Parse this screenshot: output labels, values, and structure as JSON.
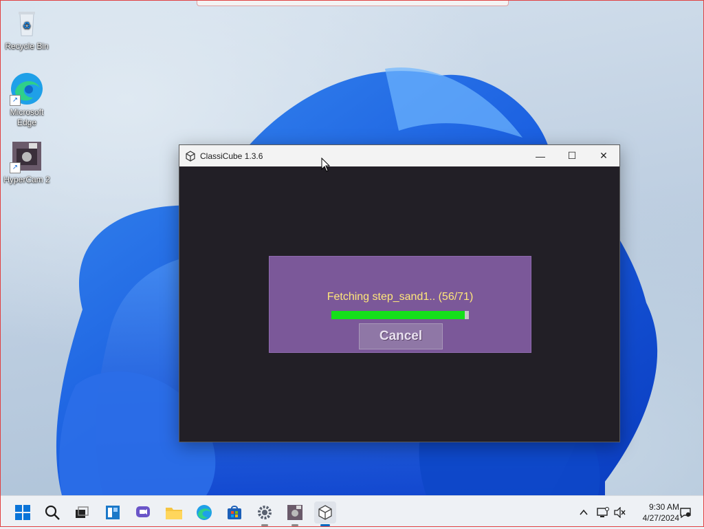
{
  "desktop": {
    "icons": [
      {
        "label": "Recycle Bin",
        "icon": "recycle-bin-icon"
      },
      {
        "label": "Microsoft\nEdge",
        "icon": "edge-icon"
      },
      {
        "label": "HyperCam 2",
        "icon": "hypercam-icon"
      }
    ]
  },
  "window": {
    "title": "ClassiCube 1.3.6",
    "icon": "classicube-cube-icon",
    "controls": {
      "minimize": "—",
      "maximize": "☐",
      "close": "✕"
    }
  },
  "dialog": {
    "status": "Fetching step_sand1.. (56/71)",
    "progress_fraction": 0.97,
    "cancel_label": "Cancel"
  },
  "taskbar": {
    "apps": [
      "start-icon",
      "search-icon",
      "task-view-icon",
      "widgets-icon",
      "chat-icon",
      "file-explorer-icon",
      "edge-icon",
      "store-icon",
      "settings-icon",
      "hypercam-icon",
      "classicube-icon"
    ],
    "tray": [
      "chevron-up-icon",
      "network-icon",
      "volume-muted-icon"
    ],
    "time": "9:30 AM",
    "date": "4/27/2024",
    "notification": "notification-icon"
  },
  "colors": {
    "dialog_bg": "#7b5899",
    "status_text": "#ffe77a",
    "progress_fill": "#15e01a",
    "window_bg": "#221f26"
  }
}
